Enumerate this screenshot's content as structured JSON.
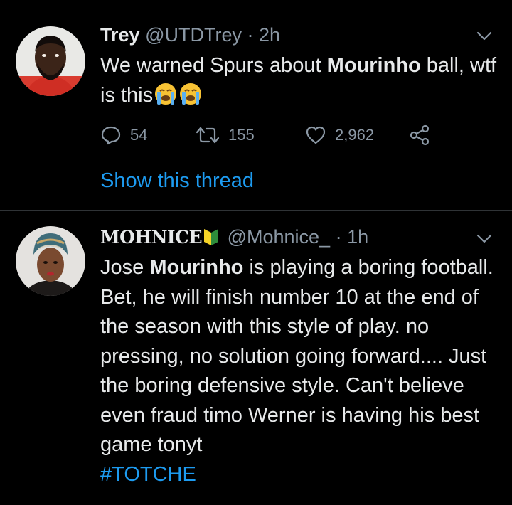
{
  "tweets": [
    {
      "name": "Trey",
      "handle": "@UTDTrey",
      "separator": "·",
      "time": "2h",
      "text_before": "We warned Spurs about ",
      "text_bold": "Mourinho",
      "text_after": " ball, wtf is this",
      "emoji": "crying-face-emoji",
      "reply_count": "54",
      "retweet_count": "155",
      "like_count": "2,962",
      "show_thread": "Show this thread"
    },
    {
      "name": "MOHNICE",
      "name_badge": "japanese-beginner-badge-icon",
      "handle": "@Mohnice_",
      "separator": "·",
      "time": "1h",
      "text_before": "Jose ",
      "text_bold": "Mourinho",
      "text_after": " is playing a boring football. Bet, he will finish number 10 at the end of the season with this style of play. no pressing, no solution going forward.... Just the boring defensive style. Can't believe even fraud timo Werner is having his best game tonyt",
      "hashtag": "#TOTCHE"
    }
  ],
  "colors": {
    "background": "#000000",
    "text": "#e7e9ea",
    "muted": "#8b98a5",
    "link": "#1d9bf0",
    "divider": "#2f3336"
  }
}
